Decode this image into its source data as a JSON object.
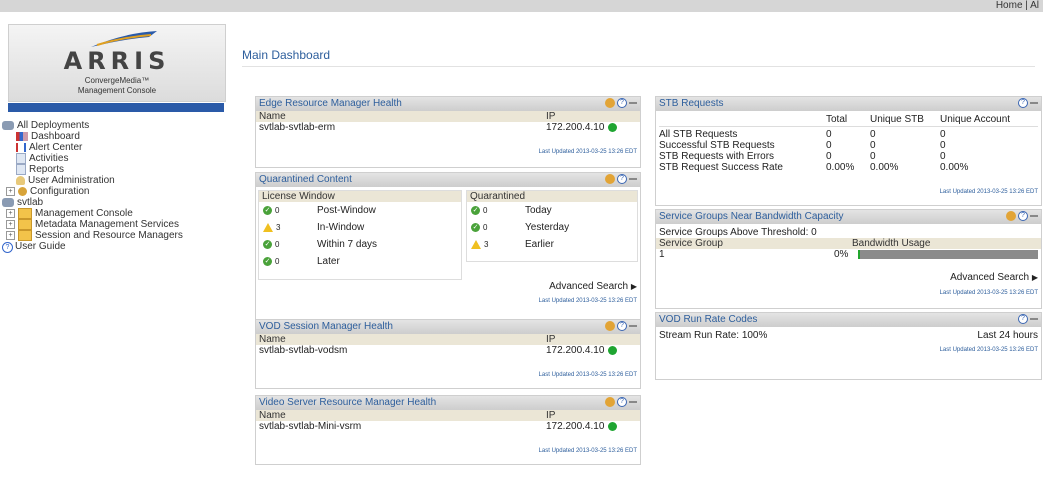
{
  "toplinks": "Home | Al",
  "logo": {
    "brand": "ARRIS",
    "product": "ConvergeMedia™",
    "subtitle": "Management Console"
  },
  "tree": [
    {
      "label": "All Deployments",
      "icon": "database-icon",
      "depth": 0
    },
    {
      "label": "Dashboard",
      "icon": "dashboard-icon",
      "depth": 1
    },
    {
      "label": "Alert Center",
      "icon": "alert-icon",
      "depth": 1
    },
    {
      "label": "Activities",
      "icon": "activities-icon",
      "depth": 1
    },
    {
      "label": "Reports",
      "icon": "reports-icon",
      "depth": 1
    },
    {
      "label": "User Administration",
      "icon": "user-icon",
      "depth": 1
    },
    {
      "label": "Configuration",
      "icon": "gear-icon",
      "depth": 1,
      "expander": "+"
    },
    {
      "label": "svtlab",
      "icon": "database-icon",
      "depth": 0
    },
    {
      "label": "Management Console",
      "icon": "folder-icon",
      "depth": 1,
      "expander": "+"
    },
    {
      "label": "Metadata Management Services",
      "icon": "folder-icon",
      "depth": 1,
      "expander": "+"
    },
    {
      "label": "Session and Resource Managers",
      "icon": "folder-icon",
      "depth": 1,
      "expander": "+"
    },
    {
      "label": "User Guide",
      "icon": "help-icon",
      "depth": 0
    }
  ],
  "page_title": "Main Dashboard",
  "colors": {
    "accent": "#2d5e9c",
    "header_bar": "#2a5aa8",
    "status_ok": "#1fa531",
    "warning": "#f0c020"
  },
  "erm": {
    "title": "Edge Resource Manager Health",
    "col_name": "Name",
    "col_ip": "IP",
    "name": "svtlab-svtlab-erm",
    "ip": "172.200.4.10",
    "updated": "Last Updated 2013-03-25 13:26 EDT"
  },
  "quarantined": {
    "title": "Quarantined Content",
    "license_header": "License Window",
    "license_rows": [
      {
        "status": "ok",
        "count": "0",
        "label": "Post-Window"
      },
      {
        "status": "warn",
        "count": "3",
        "label": "In-Window"
      },
      {
        "status": "ok",
        "count": "0",
        "label": "Within 7 days"
      },
      {
        "status": "ok",
        "count": "0",
        "label": "Later"
      }
    ],
    "q_header": "Quarantined",
    "q_rows": [
      {
        "status": "ok",
        "count": "0",
        "label": "Today"
      },
      {
        "status": "ok",
        "count": "0",
        "label": "Yesterday"
      },
      {
        "status": "warn",
        "count": "3",
        "label": "Earlier"
      }
    ],
    "advanced": "Advanced Search",
    "updated": "Last Updated 2013-03-25 13:26 EDT"
  },
  "vodsm": {
    "title": "VOD Session Manager Health",
    "col_name": "Name",
    "col_ip": "IP",
    "name": "svtlab-svtlab-vodsm",
    "ip": "172.200.4.10",
    "updated": "Last Updated 2013-03-25 13:26 EDT"
  },
  "vsrm": {
    "title": "Video Server Resource Manager Health",
    "col_name": "Name",
    "col_ip": "IP",
    "name": "svtlab-svtlab-Mini-vsrm",
    "ip": "172.200.4.10",
    "updated": "Last Updated 2013-03-25 13:26 EDT"
  },
  "stb": {
    "title": "STB Requests",
    "headers": [
      "Total",
      "Unique STB",
      "Unique Account"
    ],
    "rows": [
      {
        "label": "All STB Requests",
        "total": "0",
        "stb": "0",
        "acct": "0"
      },
      {
        "label": "Successful STB Requests",
        "total": "0",
        "stb": "0",
        "acct": "0"
      },
      {
        "label": "STB Requests with Errors",
        "total": "0",
        "stb": "0",
        "acct": "0"
      },
      {
        "label": "STB Request Success Rate",
        "total": "0.00%",
        "stb": "0.00%",
        "acct": "0.00%"
      }
    ],
    "updated": "Last Updated 2013-03-25 13:26 EDT"
  },
  "sg": {
    "title": "Service Groups Near Bandwidth Capacity",
    "threshold": "Service Groups Above Threshold: 0",
    "col_group": "Service Group",
    "col_bw": "Bandwidth Usage",
    "group": "1",
    "usage": "0%",
    "usage_fraction": 0.01,
    "advanced": "Advanced Search",
    "updated": "Last Updated 2013-03-25 13:26 EDT"
  },
  "runrate": {
    "title": "VOD Run Rate Codes",
    "left": "Stream Run Rate: 100%",
    "right": "Last 24 hours",
    "updated": "Last Updated 2013-03-25 13:26 EDT"
  }
}
